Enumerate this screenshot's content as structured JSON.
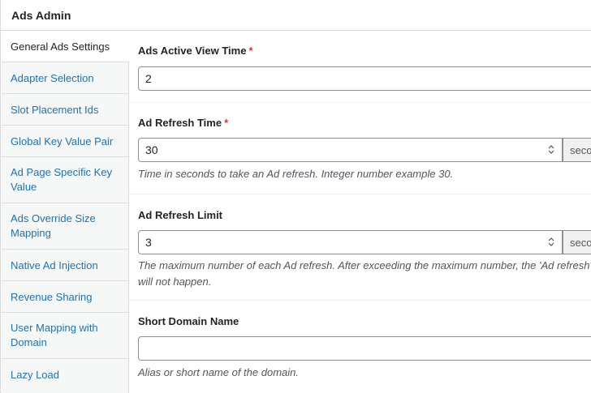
{
  "header": {
    "title": "Ads Admin"
  },
  "sidebar": {
    "items": [
      {
        "label": "General Ads Settings",
        "active": true
      },
      {
        "label": "Adapter Selection"
      },
      {
        "label": "Slot Placement Ids"
      },
      {
        "label": "Global Key Value Pair"
      },
      {
        "label": "Ad Page Specific Key Value"
      },
      {
        "label": "Ads Override Size Mapping"
      },
      {
        "label": "Native Ad Injection"
      },
      {
        "label": "Revenue Sharing"
      },
      {
        "label": "User Mapping with Domain"
      },
      {
        "label": "Lazy Load"
      }
    ]
  },
  "fields": {
    "active_view": {
      "label": "Ads Active View Time",
      "required": "*",
      "value": "2"
    },
    "refresh_time": {
      "label": "Ad Refresh Time",
      "required": "*",
      "value": "30",
      "suffix": "seconds",
      "description": "Time in seconds to take an Ad refresh. Integer number example 30."
    },
    "refresh_limit": {
      "label": "Ad Refresh Limit",
      "value": "3",
      "suffix": "seconds",
      "description_line1": "The maximum number of each Ad refresh. After exceeding the maximum number, the 'Ad refresh'",
      "description_line2": "will not happen."
    },
    "short_domain": {
      "label": "Short Domain Name",
      "value": "",
      "description": "Alias or short name of the domain."
    }
  },
  "colors": {
    "link": "#2271b1",
    "required": "#d63638",
    "text": "#1d2327",
    "muted": "#50575e"
  }
}
